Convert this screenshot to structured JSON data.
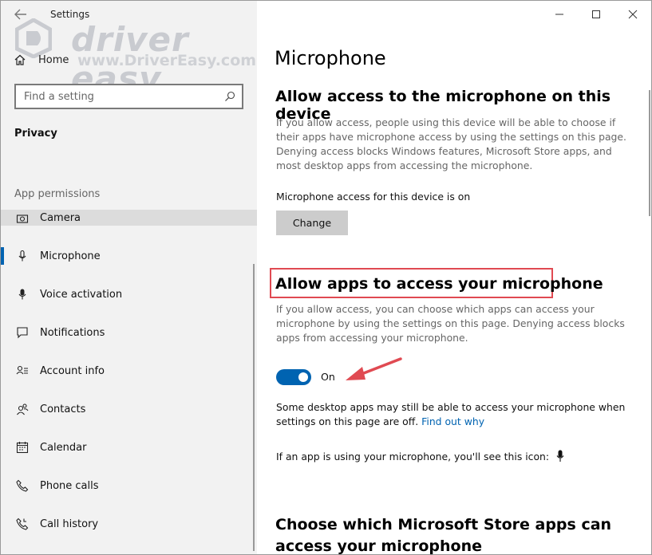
{
  "window": {
    "title": "Settings"
  },
  "watermark": {
    "brand": "driver easy",
    "url": "www.DriverEasy.com"
  },
  "sidebar": {
    "home_label": "Home",
    "search_placeholder": "Find a setting",
    "section_title": "Privacy",
    "group_title": "App permissions",
    "items": [
      {
        "label": "Camera",
        "icon": "camera-icon"
      },
      {
        "label": "Microphone",
        "icon": "microphone-icon",
        "selected": true
      },
      {
        "label": "Voice activation",
        "icon": "voice-activation-icon"
      },
      {
        "label": "Notifications",
        "icon": "notifications-icon"
      },
      {
        "label": "Account info",
        "icon": "account-info-icon"
      },
      {
        "label": "Contacts",
        "icon": "contacts-icon"
      },
      {
        "label": "Calendar",
        "icon": "calendar-icon"
      },
      {
        "label": "Phone calls",
        "icon": "phone-calls-icon"
      },
      {
        "label": "Call history",
        "icon": "call-history-icon"
      }
    ]
  },
  "content": {
    "page_title": "Microphone",
    "device_section": {
      "heading": "Allow access to the microphone on this device",
      "description": "If you allow access, people using this device will be able to choose if their apps have microphone access by using the settings on this page. Denying access blocks Windows features, Microsoft Store apps, and most desktop apps from accessing the microphone.",
      "status": "Microphone access for this device is on",
      "button_label": "Change"
    },
    "apps_section": {
      "heading": "Allow apps to access your microphone",
      "description": "If you allow access, you can choose which apps can access your microphone by using the settings on this page. Denying access blocks apps from accessing your microphone.",
      "toggle_state": "On",
      "toggle_on": true,
      "note": "Some desktop apps may still be able to access your microphone when settings on this page are off.",
      "link_text": "Find out why",
      "icon_note": "If an app is using your microphone, you'll see this icon:"
    },
    "store_section": {
      "heading": "Choose which Microsoft Store apps can access your microphone"
    }
  },
  "colors": {
    "accent": "#0063b1",
    "highlight": "#e04a52",
    "sidebar_bg": "#f2f2f2"
  }
}
